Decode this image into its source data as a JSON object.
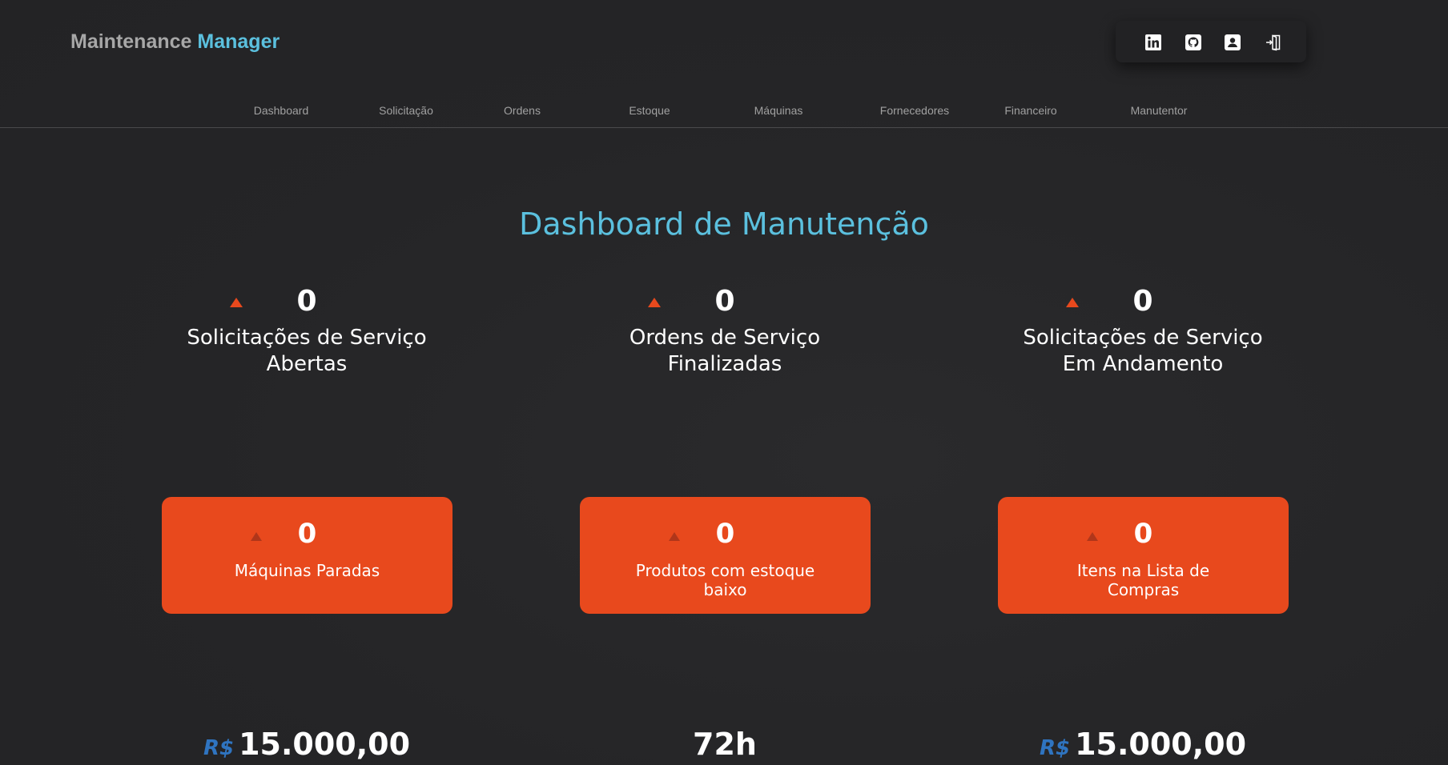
{
  "brand": {
    "part1": "Maintenance",
    "part2": "Manager"
  },
  "header_icons": [
    "linkedin-icon",
    "github-icon",
    "profile-icon",
    "logout-icon"
  ],
  "nav": [
    "Dashboard",
    "Solicitação",
    "Ordens",
    "Estoque",
    "Máquinas",
    "Fornecedores",
    "Financeiro",
    "Manutentor"
  ],
  "page_title": "Dashboard de Manutenção",
  "stats": [
    {
      "value": "0",
      "label_line1": "Solicitações de Serviço",
      "label_line2": "Abertas"
    },
    {
      "value": "0",
      "label_line1": "Ordens de Serviço",
      "label_line2": "Finalizadas"
    },
    {
      "value": "0",
      "label_line1": "Solicitações de Serviço",
      "label_line2": "Em Andamento"
    }
  ],
  "cards": [
    {
      "value": "0",
      "label_line1": "Máquinas Paradas",
      "label_line2": ""
    },
    {
      "value": "0",
      "label_line1": "Produtos com estoque",
      "label_line2": "baixo"
    },
    {
      "value": "0",
      "label_line1": "Itens na Lista de",
      "label_line2": "Compras"
    }
  ],
  "bottom": [
    {
      "currency": "R$",
      "value": "15.000,00"
    },
    {
      "currency": "",
      "value": "72h"
    },
    {
      "currency": "R$",
      "value": "15.000,00"
    }
  ],
  "colors": {
    "accent_blue": "#5bc0de",
    "accent_orange": "#e8491d",
    "currency_blue": "#2f74c0",
    "background": "#252527"
  }
}
